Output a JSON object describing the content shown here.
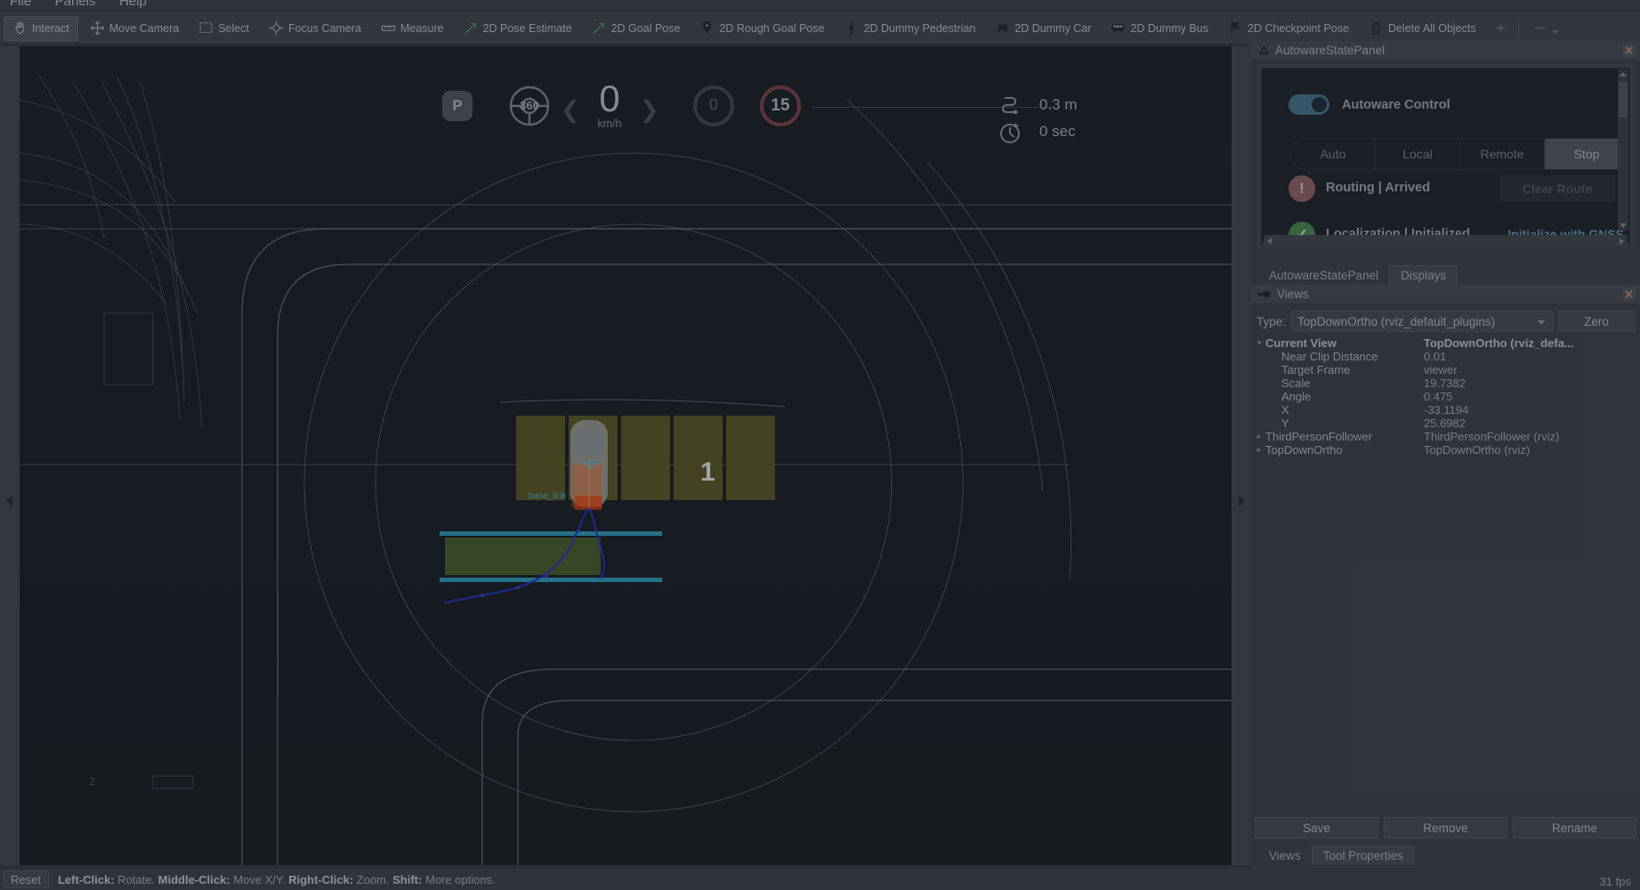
{
  "menu": {
    "items": [
      "File",
      "Panels",
      "Help"
    ]
  },
  "toolbar": {
    "tools": [
      {
        "label": "Interact",
        "icon": "hand-icon",
        "active": true
      },
      {
        "label": "Move Camera",
        "icon": "move-camera-icon",
        "active": false
      },
      {
        "label": "Select",
        "icon": "select-rect-icon",
        "active": false
      },
      {
        "label": "Focus Camera",
        "icon": "focus-camera-icon",
        "active": false
      },
      {
        "label": "Measure",
        "icon": "measure-icon",
        "active": false
      },
      {
        "label": "2D Pose Estimate",
        "icon": "pose-arrow-icon",
        "active": false
      },
      {
        "label": "2D Goal Pose",
        "icon": "pose-arrow-icon",
        "active": false
      },
      {
        "label": "2D Rough Goal Pose",
        "icon": "map-pin-icon",
        "active": false
      },
      {
        "label": "2D Dummy Pedestrian",
        "icon": "pedestrian-icon",
        "active": false
      },
      {
        "label": "2D Dummy Car",
        "icon": "car-icon",
        "active": false
      },
      {
        "label": "2D Dummy Bus",
        "icon": "bus-icon",
        "active": false
      },
      {
        "label": "2D Checkpoint Pose",
        "icon": "flag-icon",
        "active": false
      },
      {
        "label": "Delete All Objects",
        "icon": "trash-icon",
        "active": false
      }
    ],
    "add_tool_icon": "plus-icon",
    "remove_tool_icon": "minus-icon"
  },
  "hud": {
    "gear": "P",
    "steering_angle": "360",
    "speed_value": "0",
    "speed_unit": "km/h",
    "turn_signal_left_icon": "chevron-left-icon",
    "turn_signal_right_icon": "chevron-right-icon",
    "speed_limit_inactive": "0",
    "speed_limit_active": "15",
    "distance_label": "0.3 m",
    "distance_icon": "route-distance-icon",
    "time_label": "0 sec",
    "time_icon": "timer-icon"
  },
  "scene": {
    "parking_slot_label": "1",
    "vehicle_frame_label": "base_link",
    "colors": {
      "background": "#21262e",
      "parking_area": "#6d6a2c",
      "crosswalk": "#5e7a33",
      "lane_boundary": "#37b7d6",
      "lane_line": "#8b8f96",
      "trajectory": "#ff6a20",
      "path": "#2a3ad0"
    }
  },
  "autoware_panel": {
    "title": "AutowareStatePanel",
    "title_icon": "autoware-icon",
    "close_icon": "close-icon",
    "control_toggle_label": "Autoware Control",
    "control_toggle_on": true,
    "operation_modes": [
      "Auto",
      "Local",
      "Remote",
      "Stop"
    ],
    "operation_mode_selected": "Stop",
    "routing_status": "Routing | Arrived",
    "routing_icon": "warning-circle-icon",
    "clear_route_button": "Clear Route",
    "localization_status": "Localization | Initialized",
    "localization_icon": "check-circle-icon",
    "init_gnss_button": "Initialize with GNSS"
  },
  "dock_tabs_top": {
    "tabs": [
      "AutowareStatePanel",
      "Displays"
    ],
    "selected": "Displays"
  },
  "views_panel": {
    "title": "Views",
    "title_icon": "views-icon",
    "close_icon": "close-icon",
    "type_label": "Type:",
    "type_value": "TopDownOrtho (rviz_default_plugins)",
    "zero_button": "Zero",
    "properties": [
      {
        "name": "Current View",
        "value": "TopDownOrtho (rviz_defa...",
        "level": 0,
        "expander": "expanded",
        "bold": true
      },
      {
        "name": "Near Clip Distance",
        "value": "0.01",
        "level": 1,
        "expander": "",
        "bold": false
      },
      {
        "name": "Target Frame",
        "value": "viewer",
        "level": 1,
        "expander": "",
        "bold": false
      },
      {
        "name": "Scale",
        "value": "19.7382",
        "level": 1,
        "expander": "",
        "bold": false
      },
      {
        "name": "Angle",
        "value": "0.475",
        "level": 1,
        "expander": "",
        "bold": false
      },
      {
        "name": "X",
        "value": "-33.1194",
        "level": 1,
        "expander": "",
        "bold": false
      },
      {
        "name": "Y",
        "value": "25.6982",
        "level": 1,
        "expander": "",
        "bold": false
      },
      {
        "name": "ThirdPersonFollower",
        "value": "ThirdPersonFollower (rviz)",
        "level": 0,
        "expander": "collapsed",
        "bold": false
      },
      {
        "name": "TopDownOrtho",
        "value": "TopDownOrtho (rviz)",
        "level": 0,
        "expander": "collapsed",
        "bold": false
      }
    ],
    "buttons": [
      "Save",
      "Remove",
      "Rename"
    ]
  },
  "dock_tabs_bottom": {
    "tabs": [
      "Views",
      "Tool Properties"
    ],
    "selected": "Tool Properties"
  },
  "status": {
    "reset_button": "Reset",
    "hint_parts": [
      {
        "text": "Left-Click:",
        "bold": true
      },
      {
        "text": " Rotate. ",
        "bold": false
      },
      {
        "text": "Middle-Click:",
        "bold": true
      },
      {
        "text": " Move X/Y. ",
        "bold": false
      },
      {
        "text": "Right-Click:",
        "bold": true
      },
      {
        "text": " Zoom. ",
        "bold": false
      },
      {
        "text": "Shift:",
        "bold": true
      },
      {
        "text": " More options.",
        "bold": false
      }
    ],
    "fps": "31 fps"
  }
}
